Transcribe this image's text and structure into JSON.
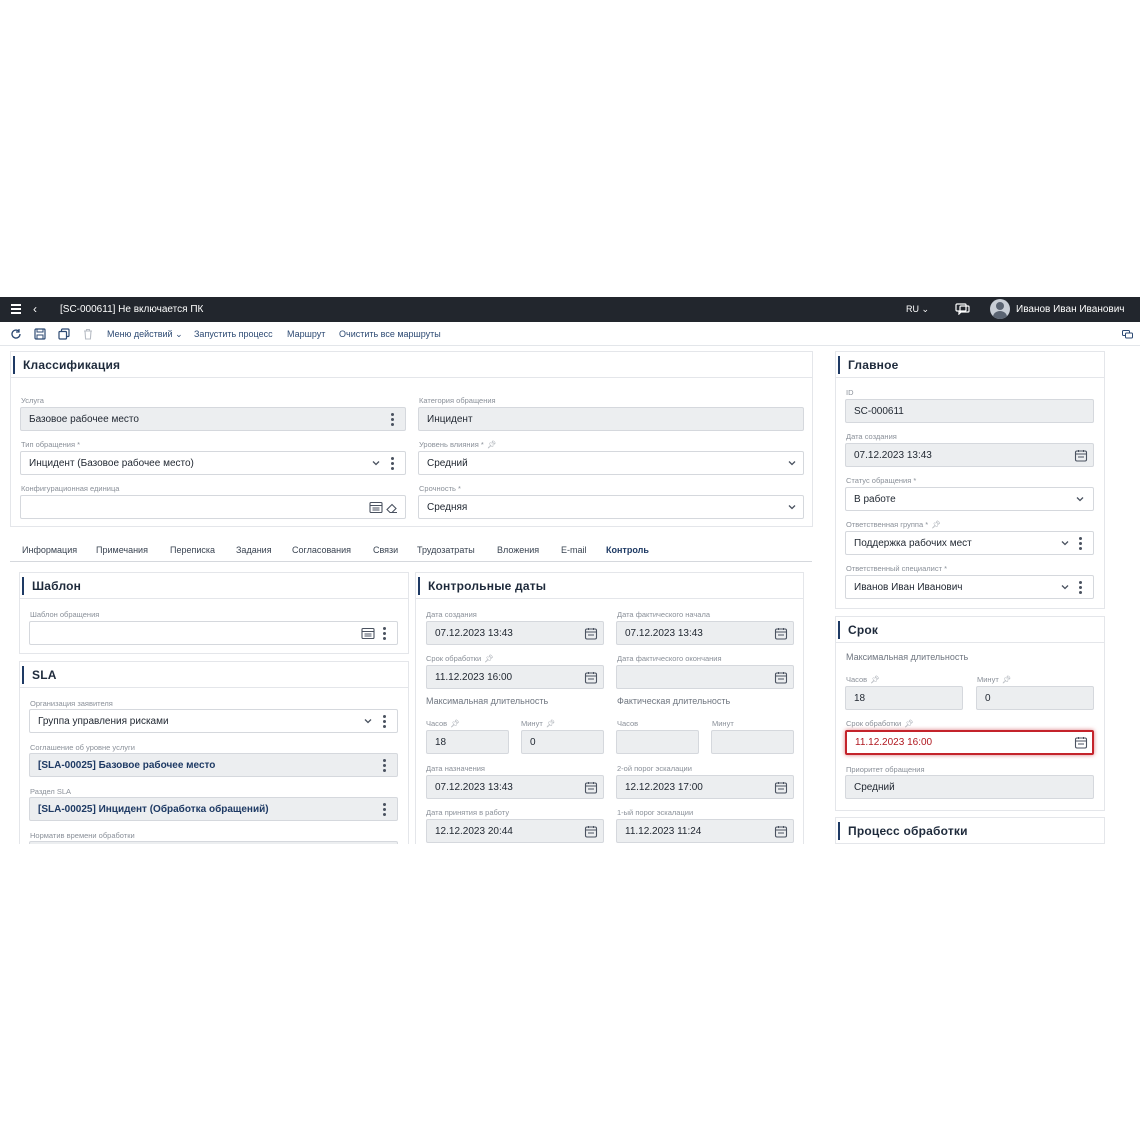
{
  "window": {
    "title": "[SC-000611] Не включается ПК",
    "language": "RU",
    "user_name": "Иванов Иван Иванович"
  },
  "toolbar": {
    "actions_menu": "Меню действий",
    "start_process": "Запустить процесс",
    "route": "Маршрут",
    "clear_routes": "Очистить все маршруты"
  },
  "classification": {
    "title": "Классификация",
    "service_label": "Услуга",
    "service_value": "Базовое рабочее место",
    "category_label": "Категория обращения",
    "category_value": "Инцидент",
    "type_label": "Тип обращения",
    "type_value": "Инцидент (Базовое рабочее место)",
    "impact_label": "Уровень влияния",
    "impact_value": "Средний",
    "ci_label": "Конфигурационная единица",
    "ci_value": "",
    "urgency_label": "Срочность",
    "urgency_value": "Средняя"
  },
  "required_mark": "*",
  "tabs": [
    "Информация",
    "Примечания",
    "Переписка",
    "Задания",
    "Согласования",
    "Связи",
    "Трудозатраты",
    "Вложения",
    "E-mail",
    "Контроль"
  ],
  "active_tab": "Контроль",
  "template": {
    "title": "Шаблон",
    "label": "Шаблон обращения",
    "value": ""
  },
  "sla": {
    "title": "SLA",
    "org_label": "Организация заявителя",
    "org_value": "Группа управления рисками",
    "agreement_label": "Соглашение об уровне услуги",
    "agreement_value": "[SLA-00025] Базовое рабочее место",
    "section_label": "Раздел SLA",
    "section_value": "[SLA-00025] Инцидент (Обработка обращений)",
    "norm_label": "Норматив времени обработки"
  },
  "control_dates": {
    "title": "Контрольные даты",
    "created_label": "Дата создания",
    "created_value": "07.12.2023 13:43",
    "actual_start_label": "Дата фактического начала",
    "actual_start_value": "07.12.2023 13:43",
    "deadline_label": "Срок обработки",
    "deadline_value": "11.12.2023 16:00",
    "actual_end_label": "Дата фактического окончания",
    "actual_end_value": "",
    "max_duration_label": "Максимальная длительность",
    "actual_duration_label": "Фактическая длительность",
    "hours_label": "Часов",
    "minutes_label": "Минут",
    "max_hours": "18",
    "max_minutes": "0",
    "act_hours": "",
    "act_minutes": "",
    "assigned_label": "Дата назначения",
    "assigned_value": "07.12.2023 13:43",
    "esc2_label": "2-ой порог эскалации",
    "esc2_value": "12.12.2023 17:00",
    "accepted_label": "Дата принятия в работу",
    "accepted_value": "12.12.2023 20:44",
    "esc1_label": "1-ый порог эскалации",
    "esc1_value": "11.12.2023 11:24"
  },
  "main": {
    "title": "Главное",
    "id_label": "ID",
    "id_value": "SC-000611",
    "created_label": "Дата создания",
    "created_value": "07.12.2023 13:43",
    "status_label": "Статус обращения",
    "status_value": "В работе",
    "group_label": "Ответственная группа",
    "group_value": "Поддержка рабочих мест",
    "specialist_label": "Ответственный специалист",
    "specialist_value": "Иванов Иван Иванович"
  },
  "deadline": {
    "title": "Срок",
    "max_duration_label": "Максимальная длительность",
    "hours_label": "Часов",
    "hours_value": "18",
    "minutes_label": "Минут",
    "minutes_value": "0",
    "deadline_label": "Срок обработки",
    "deadline_value": "11.12.2023 16:00",
    "priority_label": "Приоритет обращения",
    "priority_value": "Средний"
  },
  "process": {
    "title": "Процесс обработки"
  },
  "colors": {
    "topbar": "#22262d",
    "accent": "#1e3a64",
    "error": "#c4232b",
    "readonly": "#eceef0"
  }
}
